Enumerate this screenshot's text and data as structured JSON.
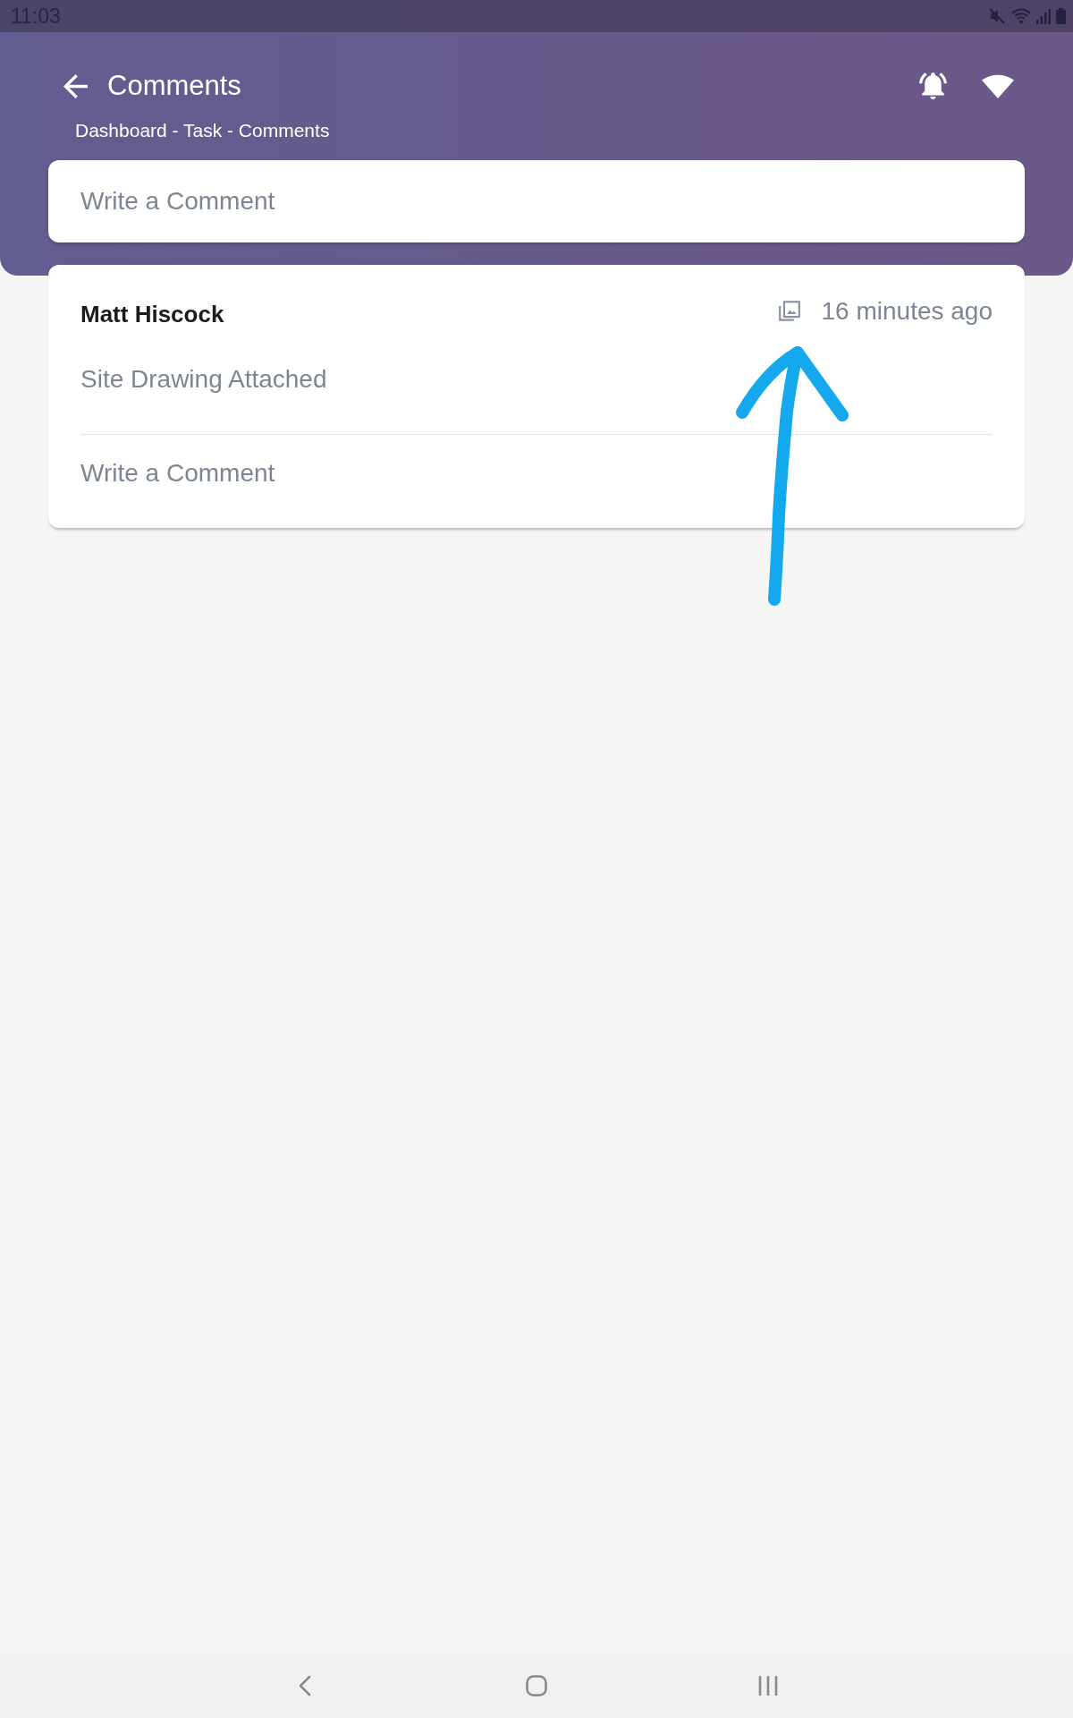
{
  "status_bar": {
    "time": "11:03"
  },
  "header": {
    "title": "Comments",
    "breadcrumb": "Dashboard - Task - Comments"
  },
  "new_comment": {
    "placeholder": "Write a Comment"
  },
  "comments": [
    {
      "author": "Matt Hiscock",
      "time": "16 minutes ago",
      "attachment": true,
      "text": "Site Drawing Attached",
      "reply": {
        "placeholder": "Write a Comment"
      }
    }
  ]
}
